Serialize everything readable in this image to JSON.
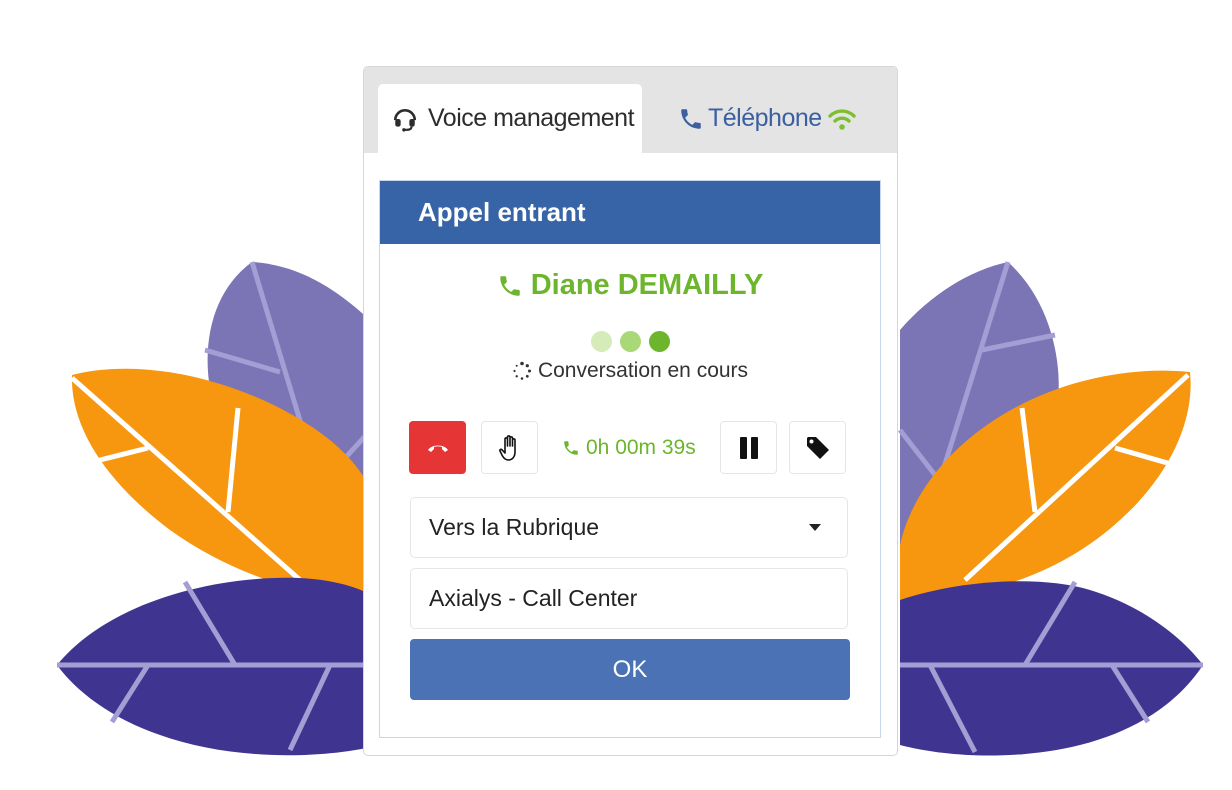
{
  "tabs": [
    {
      "label": "Voice management",
      "icon": "headset-icon",
      "active": true
    },
    {
      "label": "Téléphone",
      "icon": "phone-icon",
      "status_icon": "wifi-icon",
      "active": false
    }
  ],
  "panel": {
    "title": "Appel entrant",
    "caller_name": "Diane DEMAILLY",
    "caller_icon": "phone-icon",
    "status_text": "Conversation en cours",
    "status_icon": "spinner-icon",
    "progress_dots": 3
  },
  "controls": {
    "hangup_icon": "hangup-icon",
    "hold_icon": "hand-icon",
    "timer": "0h 00m 39s",
    "pause_icon": "pause-icon",
    "tag_icon": "tag-icon"
  },
  "form": {
    "transfer_select": "Vers la Rubrique",
    "destination_value": "Axialys - Call Center",
    "ok_label": "OK"
  },
  "colors": {
    "header_blue": "#3764a7",
    "ok_blue": "#4a72b5",
    "accent_green": "#6cb52c",
    "hangup_red": "#e63535",
    "tab_blue": "#3b5fa0",
    "leaf_orange": "#f7960f",
    "leaf_lavender": "#7b74b5",
    "leaf_indigo": "#3f3590"
  }
}
